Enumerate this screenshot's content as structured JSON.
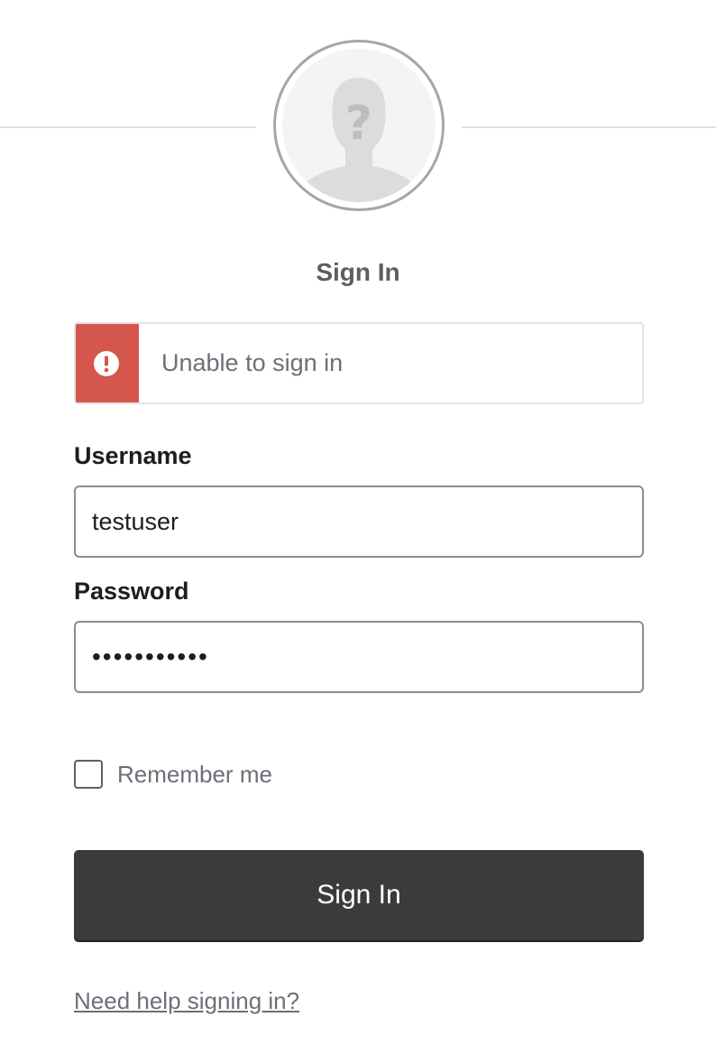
{
  "heading": {
    "title": "Sign In"
  },
  "avatar": {
    "icon": "unknown-user-icon"
  },
  "error": {
    "icon": "exclamation-circle-icon",
    "message": "Unable to sign in",
    "accent_color": "#d4564c"
  },
  "form": {
    "username_label": "Username",
    "username_value": "testuser",
    "password_label": "Password",
    "password_value": "testpass123",
    "remember_label": "Remember me",
    "remember_checked": false,
    "submit_label": "Sign In"
  },
  "help": {
    "link_text": "Need help signing in?"
  },
  "colors": {
    "button_bg": "#3b3b3b",
    "text": "#1d1d21",
    "muted": "#6e6e78"
  }
}
